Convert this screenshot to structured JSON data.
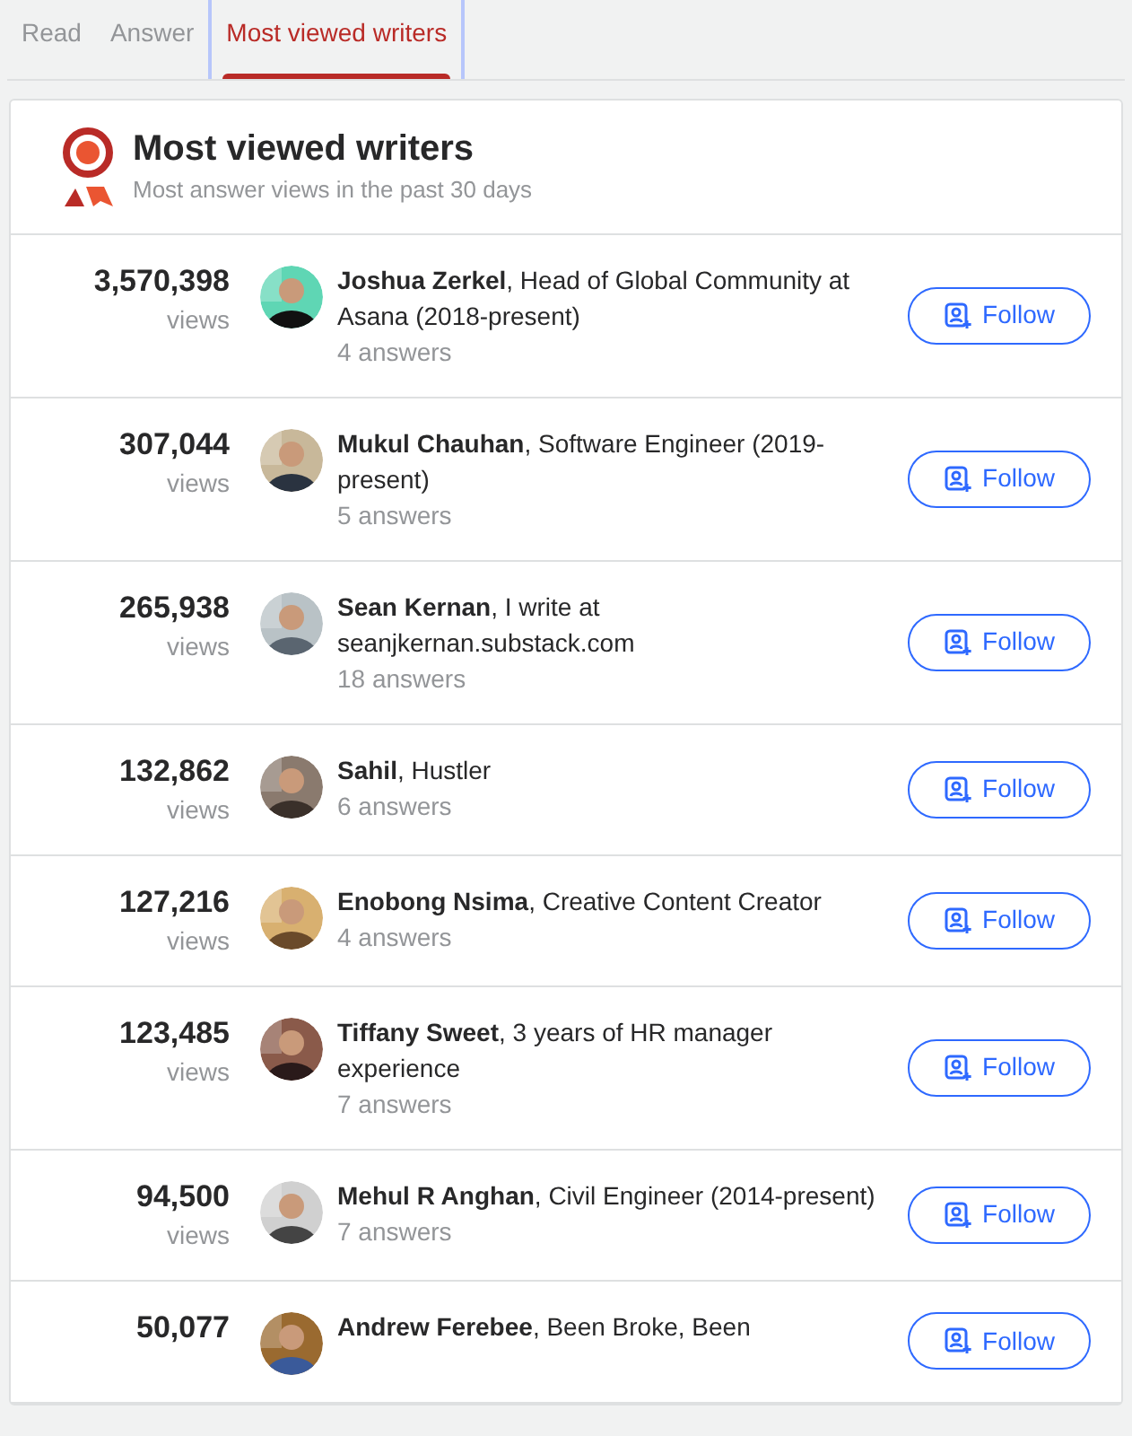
{
  "tabs": [
    {
      "label": "Read",
      "selected": false
    },
    {
      "label": "Answer",
      "selected": false
    },
    {
      "label": "Most viewed writers",
      "selected": true
    }
  ],
  "header": {
    "title": "Most viewed writers",
    "subtitle": "Most answer views in the past 30 days"
  },
  "writers": [
    {
      "count": "3,570,398",
      "unit": "views",
      "name": "Joshua Zerkel",
      "credential": ", Head of Global Community at Asana (2018-present)",
      "answers": "4 answers",
      "button": "Follow"
    },
    {
      "count": "307,044",
      "unit": "views",
      "name": "Mukul Chauhan",
      "credential": ", Software Engineer (2019-present)",
      "answers": "5 answers",
      "button": "Follow"
    },
    {
      "count": "265,938",
      "unit": "views",
      "name": "Sean Kernan",
      "credential": ", I write at seanjkernan.substack.com",
      "answers": "18 answers",
      "button": "Follow"
    },
    {
      "count": "132,862",
      "unit": "views",
      "name": "Sahil",
      "credential": ", Hustler",
      "answers": "6 answers",
      "button": "Follow"
    },
    {
      "count": "127,216",
      "unit": "views",
      "name": "Enobong Nsima",
      "credential": ", Creative Content Creator",
      "answers": "4 answers",
      "button": "Follow"
    },
    {
      "count": "123,485",
      "unit": "views",
      "name": "Tiffany Sweet",
      "credential": ", 3 years of HR manager experience",
      "answers": "7 answers",
      "button": "Follow"
    },
    {
      "count": "94,500",
      "unit": "views",
      "name": "Mehul R Anghan",
      "credential": ", Civil Engineer (2014-present)",
      "answers": "7 answers",
      "button": "Follow"
    },
    {
      "count": "50,077",
      "name": "Andrew Ferebee",
      "credential": ", Been Broke, Been",
      "button": "Follow"
    }
  ]
}
